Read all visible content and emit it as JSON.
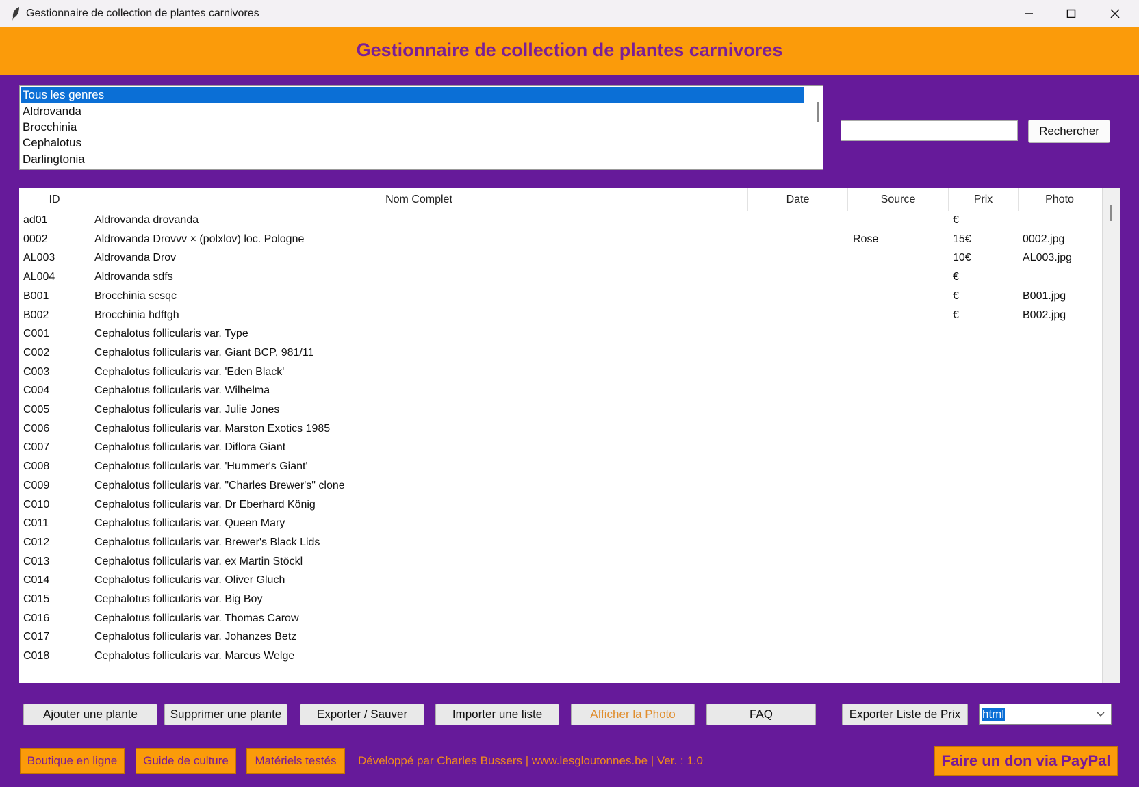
{
  "window": {
    "title": "Gestionnaire de collection de plantes carnivores"
  },
  "header": {
    "title": "Gestionnaire de collection de plantes carnivores"
  },
  "genres": [
    "Tous les genres",
    "Aldrovanda",
    "Brocchinia",
    "Cephalotus",
    "Darlingtonia"
  ],
  "search": {
    "value": "",
    "button_label": "Rechercher"
  },
  "table": {
    "columns": [
      "ID",
      "Nom Complet",
      "Date",
      "Source",
      "Prix",
      "Photo"
    ],
    "rows": [
      {
        "id": "ad01",
        "name": "Aldrovanda drovanda",
        "date": "",
        "source": "",
        "price": "€",
        "photo": ""
      },
      {
        "id": "0002",
        "name": "Aldrovanda Drovvv × (polxlov) loc. Pologne",
        "date": "",
        "source": "Rose",
        "price": "15€",
        "photo": "0002.jpg"
      },
      {
        "id": "AL003",
        "name": "Aldrovanda Drov",
        "date": "",
        "source": "",
        "price": "10€",
        "photo": "AL003.jpg"
      },
      {
        "id": "AL004",
        "name": "Aldrovanda sdfs",
        "date": "",
        "source": "",
        "price": "€",
        "photo": ""
      },
      {
        "id": "B001",
        "name": "Brocchinia scsqc",
        "date": "",
        "source": "",
        "price": "€",
        "photo": "B001.jpg"
      },
      {
        "id": "B002",
        "name": "Brocchinia hdftgh",
        "date": "",
        "source": "",
        "price": "€",
        "photo": "B002.jpg"
      },
      {
        "id": "C001",
        "name": "Cephalotus follicularis var. Type",
        "date": "",
        "source": "",
        "price": "",
        "photo": ""
      },
      {
        "id": "C002",
        "name": "Cephalotus follicularis var. Giant BCP, 981/11",
        "date": "",
        "source": "",
        "price": "",
        "photo": ""
      },
      {
        "id": "C003",
        "name": "Cephalotus follicularis var. 'Eden Black'",
        "date": "",
        "source": "",
        "price": "",
        "photo": ""
      },
      {
        "id": "C004",
        "name": "Cephalotus follicularis var. Wilhelma",
        "date": "",
        "source": "",
        "price": "",
        "photo": ""
      },
      {
        "id": "C005",
        "name": "Cephalotus follicularis var. Julie Jones",
        "date": "",
        "source": "",
        "price": "",
        "photo": ""
      },
      {
        "id": "C006",
        "name": "Cephalotus follicularis var. Marston Exotics 1985",
        "date": "",
        "source": "",
        "price": "",
        "photo": ""
      },
      {
        "id": "C007",
        "name": "Cephalotus follicularis var. Diflora Giant",
        "date": "",
        "source": "",
        "price": "",
        "photo": ""
      },
      {
        "id": "C008",
        "name": "Cephalotus follicularis var. 'Hummer's Giant'",
        "date": "",
        "source": "",
        "price": "",
        "photo": ""
      },
      {
        "id": "C009",
        "name": "Cephalotus follicularis var. \"Charles Brewer's\" clone",
        "date": "",
        "source": "",
        "price": "",
        "photo": ""
      },
      {
        "id": "C010",
        "name": "Cephalotus follicularis var. Dr Eberhard König",
        "date": "",
        "source": "",
        "price": "",
        "photo": ""
      },
      {
        "id": "C011",
        "name": "Cephalotus follicularis var. Queen Mary",
        "date": "",
        "source": "",
        "price": "",
        "photo": ""
      },
      {
        "id": "C012",
        "name": "Cephalotus follicularis var. Brewer's Black Lids",
        "date": "",
        "source": "",
        "price": "",
        "photo": ""
      },
      {
        "id": "C013",
        "name": "Cephalotus follicularis var. ex Martin Stöckl",
        "date": "",
        "source": "",
        "price": "",
        "photo": ""
      },
      {
        "id": "C014",
        "name": "Cephalotus follicularis var. Oliver Gluch",
        "date": "",
        "source": "",
        "price": "",
        "photo": ""
      },
      {
        "id": "C015",
        "name": "Cephalotus follicularis var. Big Boy",
        "date": "",
        "source": "",
        "price": "",
        "photo": ""
      },
      {
        "id": "C016",
        "name": "Cephalotus follicularis var. Thomas Carow",
        "date": "",
        "source": "",
        "price": "",
        "photo": ""
      },
      {
        "id": "C017",
        "name": "Cephalotus follicularis var. Johanzes Betz",
        "date": "",
        "source": "",
        "price": "",
        "photo": ""
      },
      {
        "id": "C018",
        "name": "Cephalotus follicularis var. Marcus Welge",
        "date": "",
        "source": "",
        "price": "",
        "photo": ""
      }
    ]
  },
  "actions": {
    "add": "Ajouter une plante",
    "delete": "Supprimer une plante",
    "export": "Exporter / Sauver",
    "import": "Importer une liste",
    "show_photo": "Afficher la Photo",
    "faq": "FAQ",
    "export_prices": "Exporter Liste de Prix",
    "format": "html"
  },
  "footer": {
    "shop": "Boutique en ligne",
    "guide": "Guide de culture",
    "materials": "Matériels testés",
    "credits": "Développé par Charles Bussers | www.lesgloutonnes.be | Ver. : 1.0",
    "paypal": "Faire un don via PayPal"
  },
  "colors": {
    "purple": "#661a9a",
    "orange": "#fb9b0a",
    "selection": "#0b6fd6",
    "title_text": "#7b1f96"
  },
  "icons": [
    "feather-icon",
    "minimize-icon",
    "maximize-icon",
    "close-icon",
    "chevron-down-icon"
  ]
}
